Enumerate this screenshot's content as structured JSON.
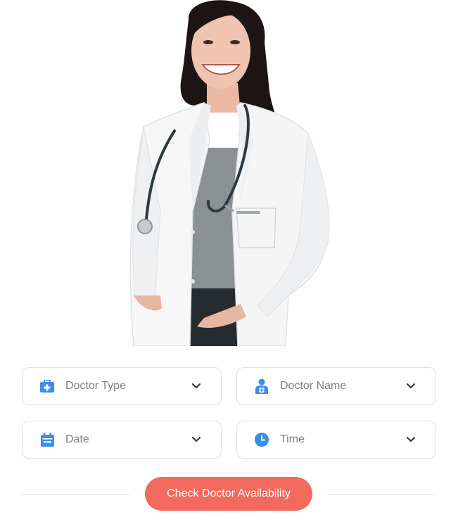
{
  "colors": {
    "icon_blue": "#3a8ee6",
    "cta_background": "#f26a5e",
    "cta_text": "#ffffff",
    "field_border": "#dde1e6",
    "field_text": "#7a8089"
  },
  "hero": {
    "image": "doctor-photo"
  },
  "form": {
    "fields": [
      {
        "label": "Doctor Type",
        "icon": "medical-bag-icon",
        "control": "dropdown"
      },
      {
        "label": "Doctor Name",
        "icon": "doctor-person-icon",
        "control": "dropdown"
      },
      {
        "label": "Date",
        "icon": "calendar-icon",
        "control": "dropdown"
      },
      {
        "label": "Time",
        "icon": "clock-icon",
        "control": "dropdown"
      }
    ],
    "submit_label": "Check Doctor Availability"
  }
}
